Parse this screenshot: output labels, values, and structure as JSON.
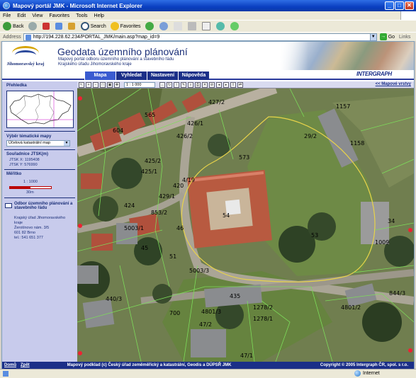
{
  "window": {
    "title": "Mapový portál JMK - Microsoft Internet Explorer"
  },
  "menu": [
    "File",
    "Edit",
    "View",
    "Favorites",
    "Tools",
    "Help"
  ],
  "toolbar": {
    "back": "Back",
    "search": "Search",
    "favorites": "Favorites"
  },
  "address": {
    "label": "Address",
    "url": "http://194.228.62.234/PORTAL_JMK/main.asp?map_id=9",
    "go": "Go",
    "links": "Links"
  },
  "header": {
    "logo_text": "Jihomoravský kraj",
    "title": "Geodata územního plánování",
    "subtitle1": "Mapový portál odboru územního plánování a stavebního řádu",
    "subtitle2": "Krajského úřadu Jihomoravského kraje"
  },
  "nav": {
    "tabs": [
      "Mapa",
      "Vyhledat",
      "Nastavení",
      "Nápověda"
    ],
    "active": 0,
    "brand": "INTERGRAPH"
  },
  "left": {
    "overview_title": "Přehledka",
    "map_select_title": "Výběr tématické mapy",
    "map_select_value": "Účelová katastrální map",
    "coords_title": "Souřadnice JTSK(m)",
    "coord_x": "JTSK X: 1195408",
    "coord_y": "JTSK Y: 576990",
    "scale_title": "Měřítko",
    "scale_value": "1 : 1000",
    "scale_len": "30m",
    "contact_title": "Odbor územního plánování a stavebního řádu",
    "contact_lines": [
      "Krajský úřad Jihomoravského",
      "kraje",
      "Žerotínovo nám. 3/5",
      "601 82 Brno",
      "tel.: 541 651 377"
    ]
  },
  "map": {
    "scale": "1 : 1 000",
    "layers_link": "<< Mapové vrstvy",
    "parcel_labels": [
      "427/2",
      "565",
      "426/1",
      "426/2",
      "604",
      "425/2",
      "425/1",
      "573",
      "4/19",
      "424",
      "429/1",
      "5003/1",
      "853/2",
      "54",
      "45",
      "51",
      "5003/3",
      "53",
      "440/3",
      "700",
      "435",
      "1278/2",
      "1278/1",
      "4801/3",
      "47/2",
      "4801/2",
      "844/3",
      "1157",
      "1158",
      "1009",
      "34",
      "420",
      "29/2",
      "46",
      "47/1"
    ]
  },
  "footer": {
    "home": "Domů",
    "back": "Zpět",
    "credit": "Mapový podklad (c) Český úřad zeměměřický a katastrální, Geodis a DÚPSŘ JMK",
    "copyright": "Copyright © 2005 Intergraph ČR, spol. s r.o."
  },
  "status": {
    "zone": "Internet"
  }
}
